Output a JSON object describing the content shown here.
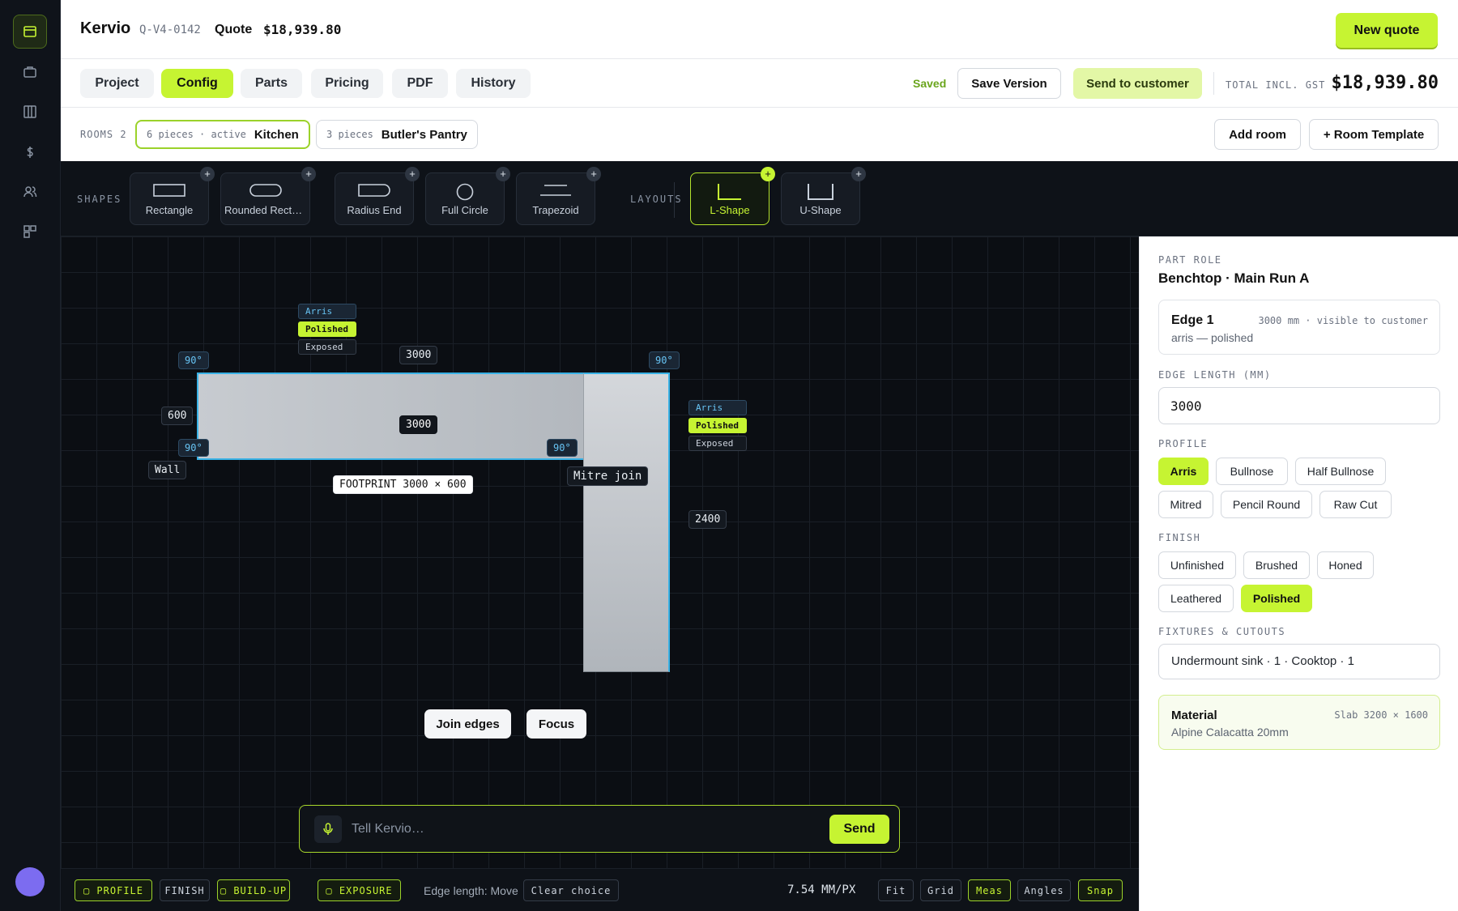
{
  "header": {
    "brand": "Kervio",
    "quote_id": "Q-V4-0142",
    "quote_word": "Quote",
    "quote_total": "$18,939.80",
    "new_quote_label": "New quote"
  },
  "tabs": [
    {
      "label": "Project",
      "active": false
    },
    {
      "label": "Config",
      "active": true
    },
    {
      "label": "Parts",
      "active": false
    },
    {
      "label": "Pricing",
      "active": false
    },
    {
      "label": "PDF",
      "active": false
    },
    {
      "label": "History",
      "active": false
    }
  ],
  "tab_actions": {
    "saved": "Saved",
    "save_version": "Save Version",
    "send_to_customer": "Send to customer",
    "total_label": "TOTAL INCL. GST",
    "total_value": "$18,939.80"
  },
  "rooms": {
    "label": "ROOMS 2",
    "items": [
      {
        "meta": "6 pieces · active",
        "name": "Kitchen",
        "active": true
      },
      {
        "meta": "3 pieces",
        "name": "Butler's Pantry",
        "active": false
      }
    ],
    "add_room": "Add room",
    "room_template": "+ Room Template"
  },
  "toolbar": {
    "shapes_label": "SHAPES",
    "shapes": [
      {
        "label": "Rectangle",
        "icon": "rectangle-icon"
      },
      {
        "label": "Rounded Recta…",
        "icon": "rounded-rectangle-icon"
      },
      {
        "label": "Radius End",
        "icon": "radius-end-icon"
      },
      {
        "label": "Full Circle",
        "icon": "circle-icon"
      },
      {
        "label": "Trapezoid",
        "icon": "trapezoid-icon"
      }
    ],
    "layouts_label": "LAYOUTS",
    "layouts": [
      {
        "label": "L-Shape",
        "icon": "l-shape-icon",
        "active": true
      },
      {
        "label": "U-Shape",
        "icon": "u-shape-icon",
        "active": false
      }
    ],
    "plus": "+"
  },
  "canvas": {
    "angles": [
      "90°",
      "90°",
      "90°",
      "90°"
    ],
    "top_length": "3000",
    "center_length": "3000",
    "depth": "600",
    "return_length": "2400",
    "wall_label": "Wall",
    "footprint": "FOOTPRINT  3000 × 600",
    "mitre_join": "Mitre join",
    "edge_tags_top": [
      "Arris",
      "Polished",
      "Exposed"
    ],
    "edge_tags_right": [
      "Arris",
      "Polished",
      "Exposed"
    ],
    "join_edges": "Join edges",
    "focus": "Focus"
  },
  "chat": {
    "placeholder": "Tell Kervio…",
    "send": "Send"
  },
  "bottom": {
    "modes": [
      {
        "label": "▢ PROFILE",
        "on": true
      },
      {
        "label": "FINISH",
        "on": false
      },
      {
        "label": "▢ BUILD-UP",
        "on": true
      },
      {
        "label": "▢ EXPOSURE",
        "on": true
      }
    ],
    "edge_length_move": "Edge length: Move",
    "clear_choice": "Clear choice",
    "scale": "7.54 MM/PX",
    "view_toggles": [
      {
        "label": "Fit",
        "on": false
      },
      {
        "label": "Grid",
        "on": false
      },
      {
        "label": "Meas",
        "on": true
      },
      {
        "label": "Angles",
        "on": false
      },
      {
        "label": "Snap",
        "on": true
      }
    ]
  },
  "panel": {
    "part_role_label": "PART ROLE",
    "part_role": "Benchtop · Main Run A",
    "edge_title": "Edge 1",
    "edge_meta": "3000 mm · visible to customer",
    "edge_sub": "arris — polished",
    "edge_length_label": "EDGE LENGTH (MM)",
    "edge_length_value": "3000",
    "profile_label": "PROFILE",
    "profiles": [
      {
        "label": "Arris",
        "on": true
      },
      {
        "label": "Bullnose",
        "on": false
      },
      {
        "label": "Half Bullnose",
        "on": false
      },
      {
        "label": "Mitred",
        "on": false
      },
      {
        "label": "Pencil Round",
        "on": false
      },
      {
        "label": "Raw Cut",
        "on": false
      }
    ],
    "finish_label": "FINISH",
    "finishes": [
      {
        "label": "Unfinished",
        "on": false
      },
      {
        "label": "Brushed",
        "on": false
      },
      {
        "label": "Honed",
        "on": false
      },
      {
        "label": "Leathered",
        "on": false
      },
      {
        "label": "Polished",
        "on": true
      }
    ],
    "fixtures_label": "FIXTURES & CUTOUTS",
    "fixtures": "Undermount sink · 1  ·  Cooktop · 1",
    "material_title": "Material",
    "material_meta": "Slab 3200 × 1600",
    "material_sub": "Alpine Calacatta 20mm"
  },
  "colors": {
    "accent": "#c6f432",
    "edge_highlight": "#39b2e6",
    "avatar": "#7c6cf0"
  }
}
